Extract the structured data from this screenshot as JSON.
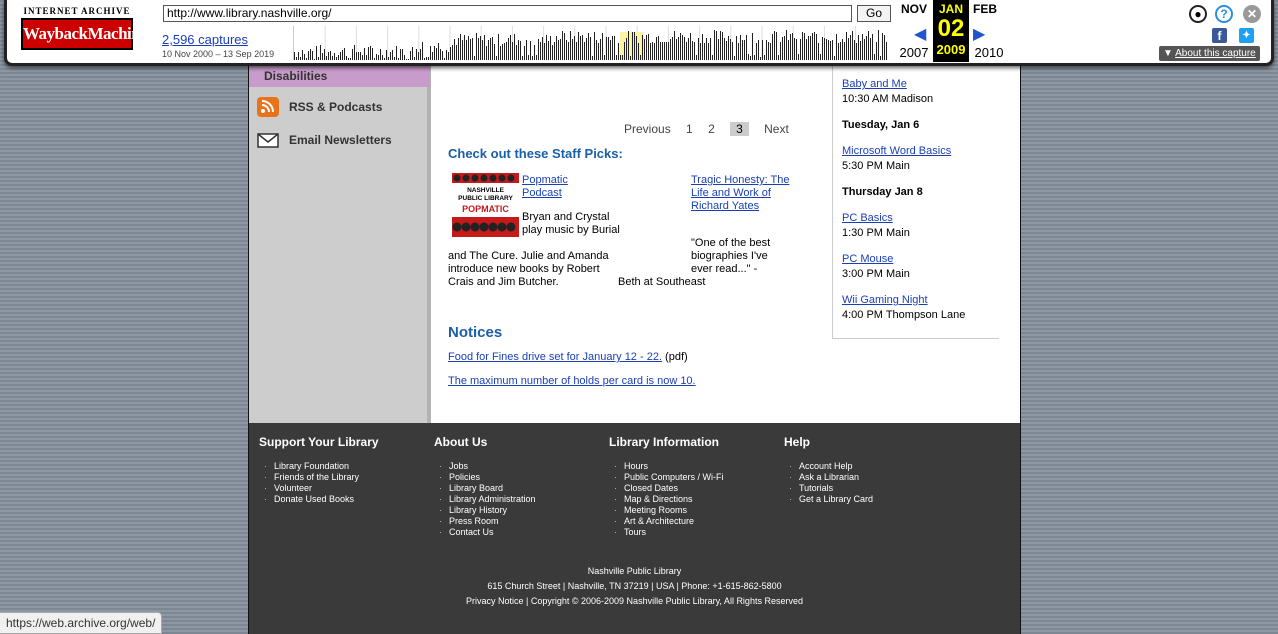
{
  "wayback": {
    "logo_top": "INTERNET ARCHIVE",
    "logo_main": "WaybackMachine",
    "url": "http://www.library.nashville.org/",
    "go_label": "Go",
    "captures": "2,596 captures",
    "range": "10 Nov 2000 – 13 Sep 2019",
    "prev_month": "NOV",
    "cur_month": "JAN",
    "next_month": "FEB",
    "cur_day": "02",
    "prev_year": "2007",
    "cur_year": "2009",
    "next_year": "2010",
    "about": "About this capture",
    "icons": [
      "user-icon",
      "help-icon",
      "close-icon",
      "facebook-icon",
      "twitter-icon"
    ]
  },
  "leftnav": {
    "disabilities": "Disabilities",
    "rss": "RSS & Podcasts",
    "email": "Email Newsletters"
  },
  "pager": {
    "prev": "Previous",
    "p1": "1",
    "p2": "2",
    "p3": "3",
    "next": "Next"
  },
  "staff_picks": {
    "title": "Check out these Staff Picks:",
    "pick1": {
      "img_line1": "NASHVILLE",
      "img_line2": "PUBLIC LIBRARY",
      "img_line3": "POPMATIC",
      "link": "Popmatic Podcast",
      "desc_top": "Bryan and Crystal play music by Burial",
      "desc_rest": "and The Cure. Julie and Amanda introduce new books by Robert Crais and Jim Butcher."
    },
    "pick2": {
      "link": "Tragic Honesty: The Life and Work of Richard Yates",
      "desc": "\"One of the best biographies I've ever read...\" -",
      "attr": "Beth at Southeast"
    }
  },
  "notices": {
    "title": "Notices",
    "items": [
      {
        "link": "Food for Fines drive set for January 12 - 22.",
        "suffix": " (pdf)"
      },
      {
        "link": "The maximum number of holds per card is now 10.",
        "suffix": ""
      }
    ]
  },
  "events": {
    "e1_link": "Baby and Me",
    "e1_text": "10:30 AM Madison",
    "d1": "Tuesday, Jan 6",
    "e2_link": "Microsoft Word Basics",
    "e2_text": "5:30 PM Main",
    "d2": "Thursday Jan 8",
    "e3_link": "PC Basics",
    "e3_text": "1:30 PM Main",
    "e4_link": "PC Mouse",
    "e4_text": "3:00 PM Main",
    "e5_link": "Wii Gaming Night",
    "e5_text": "4:00 PM Thompson Lane"
  },
  "footer": {
    "cols": [
      {
        "title": "Support Your Library",
        "items": [
          "Library Foundation",
          "Friends of the Library",
          "Volunteer",
          "Donate Used Books"
        ]
      },
      {
        "title": "About Us",
        "items": [
          "Jobs",
          "Policies",
          "Library Board",
          "Library Administration",
          "Library History",
          "Press Room",
          "Contact Us"
        ]
      },
      {
        "title": "Library Information",
        "items": [
          "Hours",
          "Public Computers / Wi-Fi",
          "Closed Dates",
          "Map & Directions",
          "Meeting Rooms",
          "Art & Architecture",
          "Tours"
        ]
      },
      {
        "title": "Help",
        "items": [
          "Account Help",
          "Ask a Librarian",
          "Tutorials",
          "Get a Library Card"
        ]
      }
    ],
    "org": "Nashville Public Library",
    "address": "615 Church Street | Nashville, TN 37219 | USA | Phone: +1-615-862-5800",
    "copyright": "Privacy Notice | Copyright © 2006-2009 Nashville Public Library, All Rights Reserved"
  },
  "status": "https://web.archive.org/web/"
}
